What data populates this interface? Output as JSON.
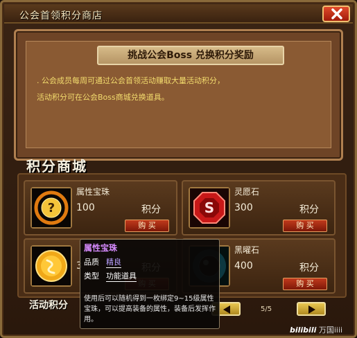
{
  "window": {
    "title": "公会首领积分商店",
    "close_icon": "close-icon"
  },
  "banner": {
    "title": "挑战公会Boss 兑换积分奖励",
    "desc_line1": ". 公会成员每周可通过公会首领活动赚取大量活动积分，",
    "desc_line2": "活动积分可在公会Boss商城兑换道具。"
  },
  "shop": {
    "title": "积分商城",
    "unit": "积分",
    "buy_label": "购 买",
    "items": [
      {
        "name": "属性宝珠",
        "price": "100",
        "icon": "question-orb-icon",
        "border_color": "#e07a10"
      },
      {
        "name": "灵愿石",
        "price": "300",
        "icon": "red-gem-icon",
        "border_color": "#d03020"
      },
      {
        "name": "",
        "price": "3",
        "icon": "gold-coin-icon",
        "border_color": "#e0a010"
      },
      {
        "name": "黑曜石",
        "price": "400",
        "icon": "dark-orb-icon",
        "border_color": "#205060"
      }
    ]
  },
  "footer": {
    "activity_points_label": "活动积分",
    "page": "5/5",
    "prev_icon": "arrow-left-icon",
    "next_icon": "arrow-right-icon"
  },
  "tooltip": {
    "name": "属性宝珠",
    "quality_label": "品质",
    "quality_value": "精良",
    "type_label": "类型",
    "type_value": "功能道具",
    "desc": "使用后可以随机得到一枚绑定9~15级属性宝珠，可以提高装备的属性，装备后发挥作用。"
  },
  "watermark": {
    "logo": "bilibili",
    "text": "万国iiii"
  }
}
